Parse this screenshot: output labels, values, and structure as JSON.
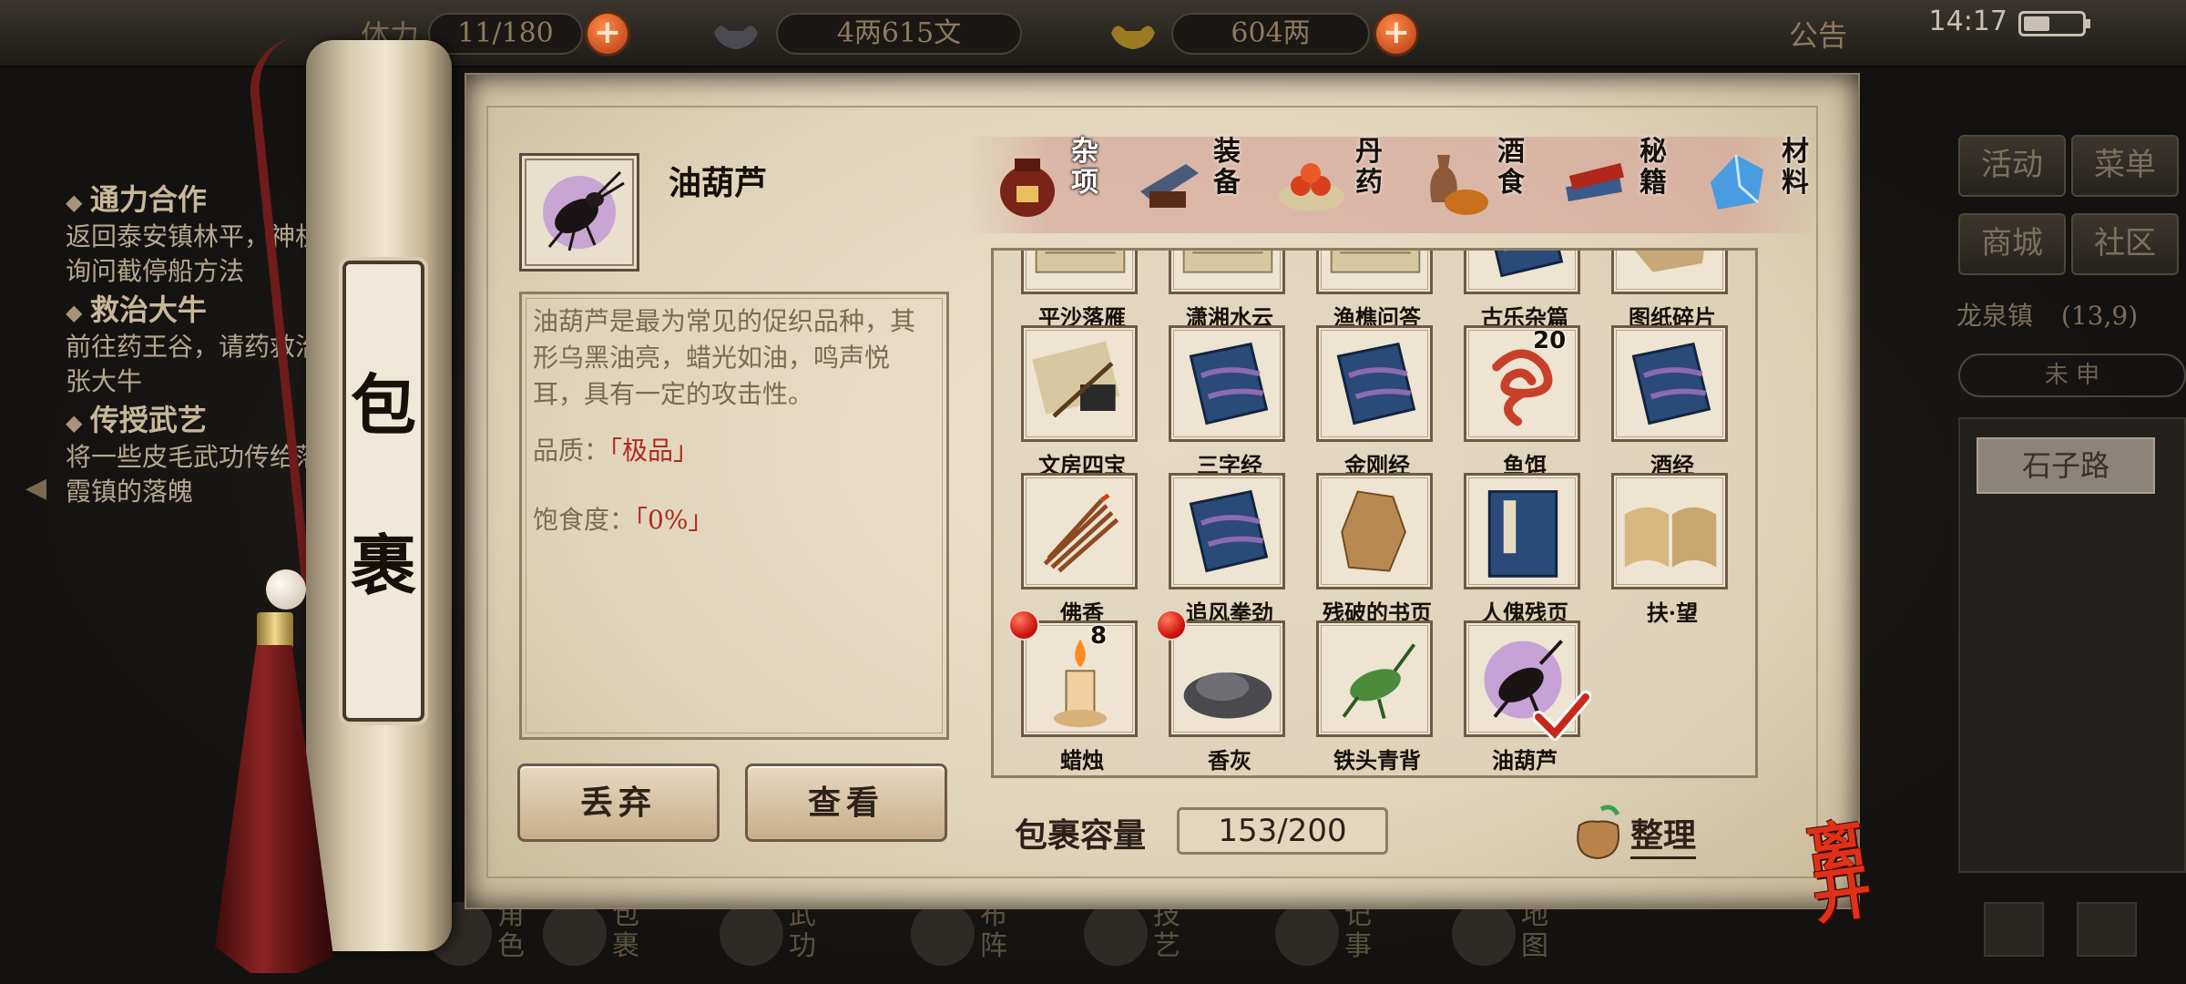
{
  "topbar": {
    "res1_prefix": "体力",
    "res1_value": "11/180",
    "money_value": "4两615文",
    "gold_value": "604两",
    "notice_label": "公告",
    "time": "14:17"
  },
  "quests": [
    {
      "title": "通力合作",
      "desc": "返回泰安镇林平，神机询问截停船方法"
    },
    {
      "title": "救治大牛",
      "desc": "前往药王谷，请药救治张大牛"
    },
    {
      "title": "传授武艺",
      "desc": "将一些皮毛武功传给落霞镇的落魄"
    }
  ],
  "scroll": {
    "title_top": "包",
    "title_bottom": "裹"
  },
  "selected": {
    "name": "油葫芦",
    "description": "油葫芦是最为常见的促织品种，其形乌黑油亮，蜡光如油，鸣声悦耳，具有一定的攻击性。",
    "quality_label": "品质：",
    "quality_value": "「极品」",
    "satiety_label": "饱食度：",
    "satiety_value": "「0%」"
  },
  "tabs": [
    {
      "label": "杂项",
      "icon": "jar-icon",
      "active": true
    },
    {
      "label": "装备",
      "icon": "equipment-icon"
    },
    {
      "label": "丹药",
      "icon": "pills-icon"
    },
    {
      "label": "酒食",
      "icon": "wine-food-icon"
    },
    {
      "label": "秘籍",
      "icon": "books-icon"
    },
    {
      "label": "材料",
      "icon": "crystal-icon"
    }
  ],
  "items": [
    {
      "label": "平沙落雁",
      "icon": "scroll-sheet-icon"
    },
    {
      "label": "潇湘水云",
      "icon": "scroll-sheet-icon"
    },
    {
      "label": "渔樵问答",
      "icon": "scroll-sheet-icon"
    },
    {
      "label": "古乐杂篇",
      "icon": "blue-book-icon"
    },
    {
      "label": "图纸碎片",
      "icon": "paper-fragment-icon"
    },
    {
      "label": "文房四宝",
      "icon": "scholar-set-icon"
    },
    {
      "label": "三字经",
      "icon": "blue-book-icon"
    },
    {
      "label": "金刚经",
      "icon": "blue-book-icon"
    },
    {
      "label": "鱼饵",
      "icon": "worm-icon",
      "count": "20"
    },
    {
      "label": "酒经",
      "icon": "blue-book-icon"
    },
    {
      "label": "佛香",
      "icon": "incense-icon"
    },
    {
      "label": "追风拳劲",
      "icon": "blue-book-icon"
    },
    {
      "label": "残破的书页",
      "icon": "torn-page-icon"
    },
    {
      "label": "人傀残页",
      "icon": "manual-icon"
    },
    {
      "label": "扶·望",
      "icon": "open-book-icon"
    },
    {
      "label": "蜡烛",
      "icon": "candle-icon",
      "count": "8",
      "new": true
    },
    {
      "label": "香灰",
      "icon": "ash-pile-icon",
      "new": true
    },
    {
      "label": "铁头青背",
      "icon": "green-cricket-icon"
    },
    {
      "label": "油葫芦",
      "icon": "black-cricket-icon",
      "selected": true
    }
  ],
  "buttons": {
    "discard": "丢弃",
    "view": "查看"
  },
  "capacity": {
    "label": "包裹容量",
    "value": "153/200"
  },
  "sort_label": "整理",
  "exit_label": "离开",
  "right_panel": {
    "btn_activity": "活动",
    "btn_menu": "菜单",
    "btn_shop": "商城",
    "btn_community": "社区",
    "location": "龙泉镇",
    "coords": "(13,9)",
    "time_strip": "未 申",
    "road": "石子路"
  },
  "bottom_nav": [
    {
      "label": "角色",
      "icon": "character-icon"
    },
    {
      "label": "包裹",
      "icon": "bag-icon"
    },
    {
      "label": "武功",
      "icon": "martial-icon"
    },
    {
      "label": "布阵",
      "icon": "formation-icon"
    },
    {
      "label": "技艺",
      "icon": "skill-icon"
    },
    {
      "label": "记事",
      "icon": "journal-icon"
    },
    {
      "label": "地图",
      "icon": "map-icon"
    }
  ],
  "colors": {
    "accent_red": "#b02a22",
    "paper": "#e6dcc6",
    "ink": "#151008"
  }
}
